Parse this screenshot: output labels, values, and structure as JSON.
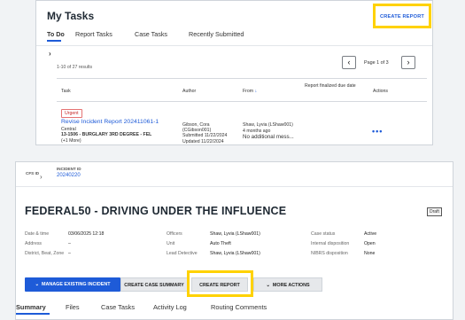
{
  "tasks": {
    "title": "My Tasks",
    "tabs": [
      "To Do",
      "Report Tasks",
      "Case Tasks",
      "Recently Submitted"
    ],
    "create_report": "CREATE REPORT",
    "results_count": "1-10 of 27 results",
    "page_indicator": "Page 1 of 3",
    "columns": [
      "Task",
      "Author",
      "From",
      "Report finalized due date",
      "Actions"
    ],
    "row": {
      "badge": "Urgent",
      "task_title": "Revise Incident Report 202411061-1",
      "task_line1": "Central",
      "task_line2": "13-1506 - BURGLARY 3RD DEGREE - FEL",
      "task_line3": "(+1 More)",
      "author_line1": "Gibson, Cora",
      "author_line2": "(CGibson001)",
      "author_line3": "Submitted 11/22/2024",
      "author_line4": "Updated 11/22/2024",
      "from_line1": "Shaw, Lyvia (LShaw001)",
      "from_line2": "4 months ago",
      "from_line3": "No additional mess..."
    }
  },
  "incident": {
    "cfs_label": "CFS ID",
    "incident_id_label": "INCIDENT ID",
    "incident_id": "20240220",
    "title": "FEDERAL50 - DRIVING UNDER THE INFLUENCE",
    "status_badge": "Draft",
    "details": {
      "date_time_label": "Date & time",
      "date_time": "03/06/2025 12:18",
      "address_label": "Address",
      "address": "–",
      "district_label": "District, Beat, Zone",
      "district": "–",
      "officers_label": "Officers",
      "officers": "Shaw, Lyvia (LShaw001)",
      "unit_label": "Unit",
      "unit": "Auto Theft",
      "lead_label": "Lead Detective",
      "lead": "Shaw, Lyvia (LShaw001)",
      "case_status_label": "Case status",
      "case_status": "Active",
      "internal_disp_label": "Internal disposition",
      "internal_disp": "Open",
      "nibrs_label": "NIBRS disposition",
      "nibrs": "None"
    },
    "buttons": {
      "manage": "MANAGE EXISTING INCIDENT",
      "summary": "CREATE CASE SUMMARY",
      "create_report": "CREATE REPORT",
      "more": "MORE ACTIONS"
    },
    "tabs": [
      "Summary",
      "Files",
      "Case Tasks",
      "Activity Log",
      "Routing Comments"
    ]
  }
}
